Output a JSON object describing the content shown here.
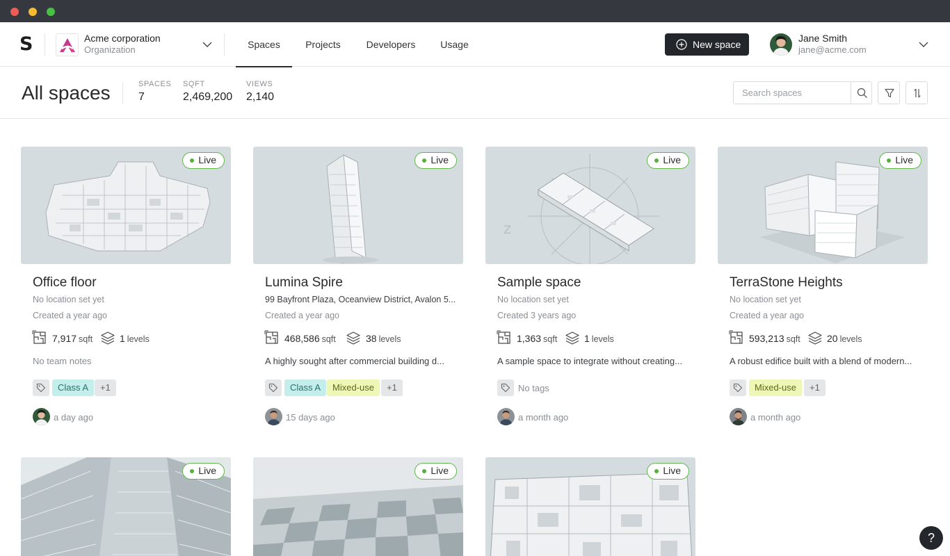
{
  "app": {
    "logo": "S"
  },
  "org": {
    "name": "Acme corporation",
    "subtitle": "Organization"
  },
  "nav": {
    "tabs": [
      {
        "label": "Spaces"
      },
      {
        "label": "Projects"
      },
      {
        "label": "Developers"
      },
      {
        "label": "Usage"
      }
    ]
  },
  "new_space": {
    "label": "New space"
  },
  "user": {
    "name": "Jane Smith",
    "email": "jane@acme.com"
  },
  "page": {
    "title": "All spaces",
    "stats": [
      {
        "label": "SPACES",
        "value": "7"
      },
      {
        "label": "SQFT",
        "value": "2,469,200"
      },
      {
        "label": "VIEWS",
        "value": "2,140"
      }
    ]
  },
  "search": {
    "placeholder": "Search spaces"
  },
  "colors": {
    "live_border": "#61b84a",
    "live_dot": "#56b13c",
    "tag_teal": "#c3eeeb",
    "tag_lime": "#eef7b6",
    "primary_button": "#23272c"
  },
  "cards": [
    {
      "title": "Office floor",
      "location": "No location set yet",
      "created": "Created a year ago",
      "sqft": "7,917",
      "sqft_unit": "sqft",
      "levels": "1",
      "levels_unit": "levels",
      "note": "No team notes",
      "tag1": "Class A",
      "tag_more": "+1",
      "time": "a day ago",
      "status": "Live"
    },
    {
      "title": "Lumina Spire",
      "location": "99 Bayfront Plaza, Oceanview District, Avalon 5...",
      "created": "Created a year ago",
      "sqft": "468,586",
      "sqft_unit": "sqft",
      "levels": "38",
      "levels_unit": "levels",
      "note": "A highly sought after commercial building d...",
      "tag1": "Class A",
      "tag2": "Mixed-use",
      "tag_more": "+1",
      "time": "15 days ago",
      "status": "Live"
    },
    {
      "title": "Sample space",
      "location": "No location set yet",
      "created": "Created 3 years ago",
      "sqft": "1,363",
      "sqft_unit": "sqft",
      "levels": "1",
      "levels_unit": "levels",
      "note": "A sample space to integrate without creating...",
      "no_tags": "No tags",
      "time": "a month ago",
      "status": "Live"
    },
    {
      "title": "TerraStone Heights",
      "location": "No location set yet",
      "created": "Created a year ago",
      "sqft": "593,213",
      "sqft_unit": "sqft",
      "levels": "20",
      "levels_unit": "levels",
      "note": "A robust edifice built with a blend of modern...",
      "tag1": "Mixed-use",
      "tag_more": "+1",
      "time": "a month ago",
      "status": "Live"
    },
    {
      "status": "Live"
    },
    {
      "status": "Live"
    },
    {
      "status": "Live"
    }
  ],
  "help": {
    "label": "?"
  }
}
